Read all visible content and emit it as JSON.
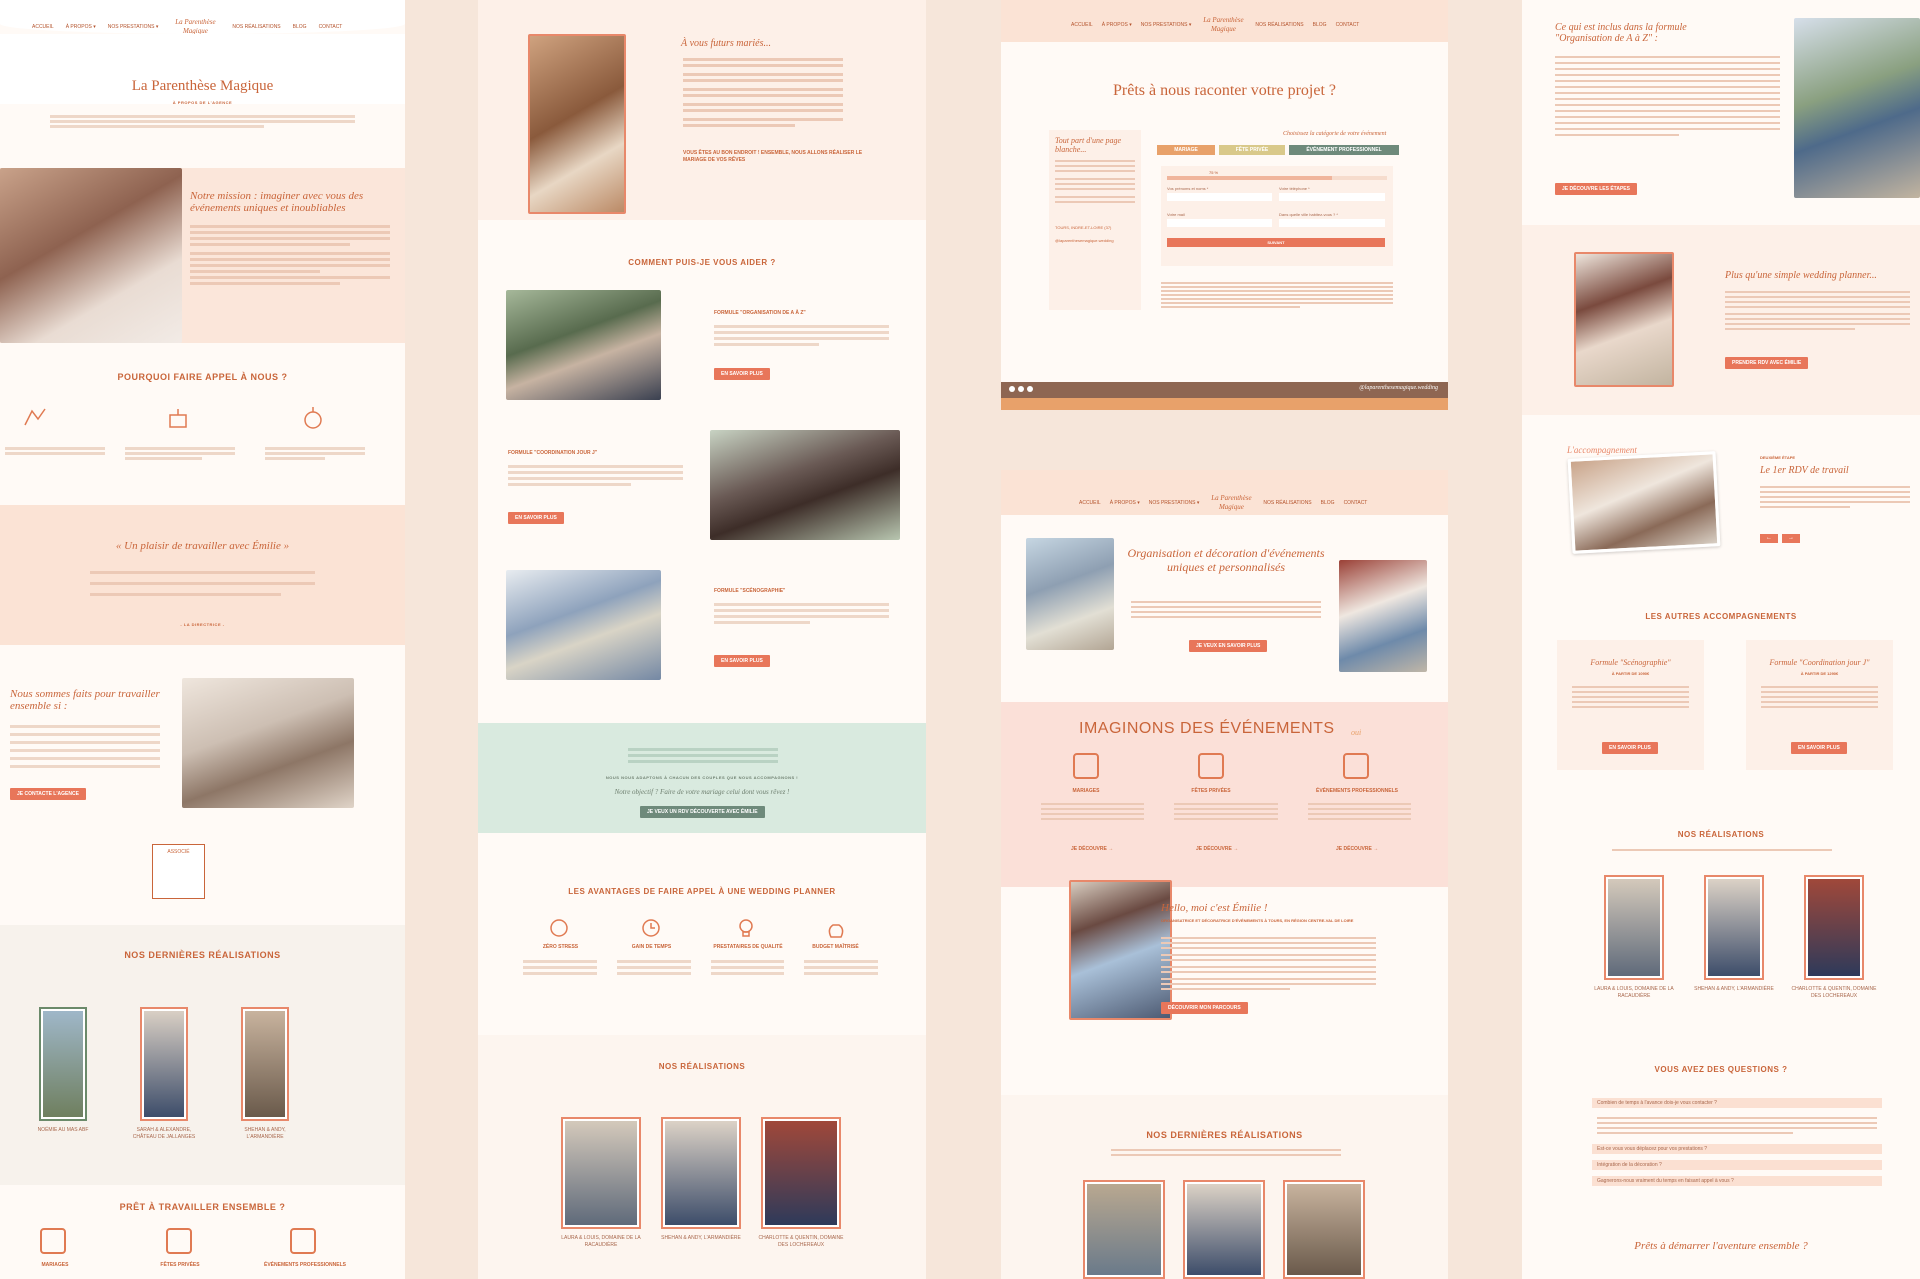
{
  "nav": {
    "items": [
      "ACCUEIL",
      "À PROPOS ▾",
      "NOS PRESTATIONS ▾",
      "NOS RÉALISATIONS",
      "BLOG",
      "CONTACT"
    ],
    "logo": "La Parenthèse Magique"
  },
  "col1": {
    "title": "La Parenthèse Magique",
    "subtitle": "À PROPOS DE L'AGENCE",
    "mission_title": "Notre mission : imaginer avec vous des événements uniques et inoubliables",
    "why_title": "POURQUOI FAIRE APPEL À NOUS ?",
    "quote_title": "« Un plaisir de travailler avec Émilie »",
    "quote_author": "- LA DIRECTRICE -",
    "together_title": "Nous sommes faits pour travailler ensemble si :",
    "contact_btn": "JE CONTACTE L'AGENCE",
    "badge": "ASSOCIÉ",
    "realisations_title": "NOS DERNIÈRES RÉALISATIONS",
    "realisations": [
      "NOÉMIE AU MAS ABF",
      "SARAH & ALEXANDRE, CHÂTEAU DE JALLANGES",
      "SHEHAN & ANDY, L'ARMANDIÈRE"
    ],
    "ready_title": "PRÊT À TRAVAILLER ENSEMBLE ?",
    "categories": [
      "MARIAGES",
      "FÊTES PRIVÉES",
      "ÉVÉNEMENTS PROFESSIONNELS"
    ]
  },
  "col2": {
    "future_title": "À vous futurs mariés...",
    "future_cta": "VOUS ÊTES AU BON ENDROIT ! ENSEMBLE, NOUS ALLONS RÉALISER LE MARIAGE DE VOS RÊVES",
    "help_title": "COMMENT PUIS-JE VOUS AIDER ?",
    "formulas": [
      "FORMULE \"ORGANISATION DE A À Z\"",
      "FORMULE \"COORDINATION JOUR J\"",
      "FORMULE \"SCÉNOGRAPHIE\""
    ],
    "more_btn": "EN SAVOIR PLUS",
    "adapt_text": "NOUS NOUS ADAPTONS À CHACUN DES COUPLES QUE NOUS ACCOMPAGNONS !",
    "objective": "Notre objectif ? Faire de votre mariage celui dont vous rêvez !",
    "objective_btn": "JE VEUX UN RDV DÉCOUVERTE AVEC ÉMILIE",
    "advantages_title": "LES AVANTAGES DE FAIRE APPEL À UNE WEDDING PLANNER",
    "advantages": [
      "ZÉRO STRESS",
      "GAIN DE TEMPS",
      "PRESTATAIRES DE QUALITÉ",
      "BUDGET MAÎTRISÉ"
    ],
    "realisations_title": "NOS RÉALISATIONS",
    "realisations": [
      "LAURA & LOUIS, DOMAINE DE LA RACAUDIÈRE",
      "SHEHAN & ANDY, L'ARMANDIÈRE",
      "CHARLOTTE & QUENTIN, DOMAINE DES LOCHEREAUX"
    ]
  },
  "col3": {
    "project_title": "Prêts à nous raconter votre projet ?",
    "blank_title": "Tout part d'une page blanche...",
    "choose_label": "Choisissez la catégorie de votre événement",
    "tabs": [
      "MARIAGE",
      "FÊTE PRIVÉE",
      "ÉVÉNEMENT PROFESSIONNEL"
    ],
    "progress": "75 %",
    "fields": [
      "Vos prénoms et noms *",
      "Votre téléphone *",
      "Votre mail",
      "Dans quelle ville habitez-vous ? *"
    ],
    "submit": "SUIVANT",
    "address": "TOURS, INDRE-ET-LOIRE (37)",
    "instagram": "@laparenthesemagique.wedding",
    "hero_title": "Organisation et décoration d'événements uniques et personnalisés",
    "hero_btn": "JE VEUX EN SAVOIR PLUS",
    "imagine_title": "IMAGINONS DES ÉVÉNEMENTS",
    "imagine_word": "oui",
    "categories": [
      "MARIAGES",
      "FÊTES PRIVÉES",
      "ÉVÉNEMENTS PROFESSIONNELS"
    ],
    "discover": "JE DÉCOUVRE →",
    "hello_title": "Hello, moi c'est Émilie !",
    "hello_sub": "ORGANISATRICE ET DÉCORATRICE D'ÉVÉNEMENTS À TOURS, EN RÉGION CENTRE-VAL DE LOIRE",
    "hello_btn": "DÉCOUVRIR MON PARCOURS",
    "realisations_title": "NOS DERNIÈRES RÉALISATIONS"
  },
  "col4": {
    "included_title": "Ce qui est inclus dans la formule \"Organisation de A à Z\" :",
    "steps_btn": "JE DÉCOUVRE LES ÉTAPES",
    "more_title": "Plus qu'une simple wedding planner...",
    "more_btn": "PRENDRE RDV AVEC ÉMILIE",
    "step_label": "L'accompagnement",
    "step_sub": "DEUXIÈME ÉTAPE",
    "step_title": "Le 1er RDV de travail",
    "others_title": "LES AUTRES ACCOMPAGNEMENTS",
    "offers": [
      {
        "title": "Formule \"Scénographie\"",
        "price": "À PARTIR DE 1090€"
      },
      {
        "title": "Formule \"Coordination jour J\"",
        "price": "À PARTIR DE 1290€"
      }
    ],
    "more_link": "EN SAVOIR PLUS",
    "realisations_title": "NOS RÉALISATIONS",
    "realisations": [
      "LAURA & LOUIS, DOMAINE DE LA RACAUDIÈRE",
      "SHEHAN & ANDY, L'ARMANDIÈRE",
      "CHARLOTTE & QUENTIN, DOMAINE DES LOCHEREAUX"
    ],
    "faq_title": "VOUS AVEZ DES QUESTIONS ?",
    "faqs": [
      "Combien de temps à l'avance dois-je vous contacter ?",
      "Est-ce vous vous déplacez pour vos prestations ?",
      "Intégration de la décoration ?",
      "Gagnerons-nous vraiment du temps en faisant appel à vous ?"
    ],
    "ready_title": "Prêts à démarrer l'aventure ensemble ?"
  },
  "colors": {
    "accent": "#e8765a",
    "text": "#c9653a",
    "pink_band": "#fbe0d2",
    "green_band": "#d9eadf"
  }
}
